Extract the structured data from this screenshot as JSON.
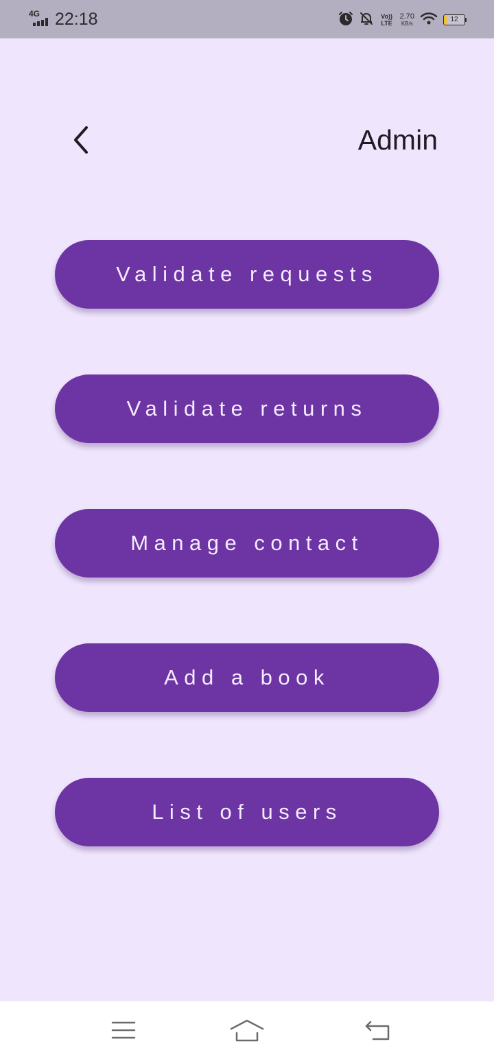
{
  "status_bar": {
    "network": "4G",
    "time": "22:18",
    "volte": "Vo)) LTE",
    "speed_value": "2.70",
    "speed_unit": "KB/s",
    "battery_level": "12",
    "battery_fraction": 0.12,
    "icons": [
      "signal-icon",
      "alarm-icon",
      "bell-off-icon",
      "wifi-icon",
      "battery-icon"
    ]
  },
  "header": {
    "title": "Admin",
    "back_icon": "back-arrow-icon"
  },
  "menu": {
    "items": [
      {
        "label": "Validate requests"
      },
      {
        "label": "Validate returns"
      },
      {
        "label": "Manage contact"
      },
      {
        "label": "Add a book"
      },
      {
        "label": "List of users"
      }
    ]
  },
  "nav_bar": {
    "icons": [
      "menu-icon",
      "home-icon",
      "back-icon"
    ]
  },
  "colors": {
    "background": "#efe5fc",
    "button": "#6d34a3",
    "button_text": "#f5ecff",
    "status_bar": "#b4aec1",
    "battery_fill": "#f2c230"
  }
}
